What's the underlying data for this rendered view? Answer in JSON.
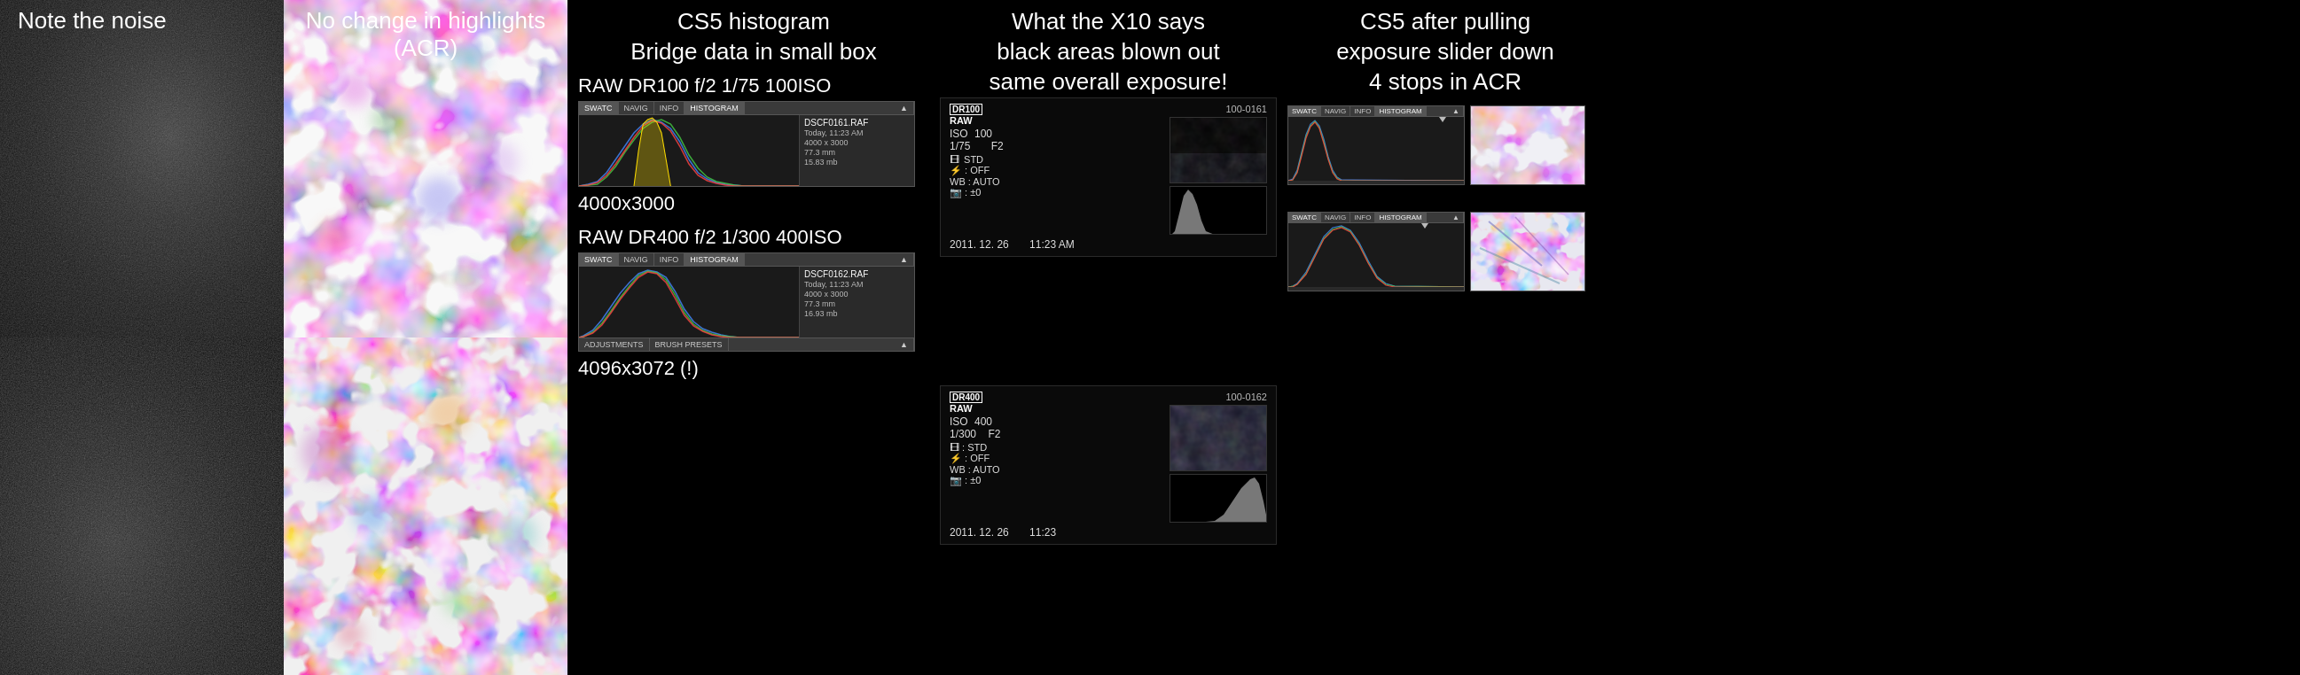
{
  "col1": {
    "label": "Note the noise"
  },
  "col2": {
    "label": "No change in highlights (ACR)"
  },
  "col3": {
    "label_line1": "CS5 histogram",
    "label_line2": "Bridge data in small box",
    "top_raw_label": "RAW DR100 f/2 1/75 100ISO",
    "top_size": "4000x3000",
    "top_filename": "DSCF0161.RAF",
    "top_file_info1": "Today, 11:23 AM",
    "top_file_info2": "4000 x 3000",
    "top_file_info3": "77.3 mm",
    "top_file_info4": "15.83 mb",
    "bottom_raw_label": "RAW DR400 f/2 1/300 400ISO",
    "bottom_size": "4096x3072 (!)",
    "bottom_filename": "DSCF0162.RAF",
    "bottom_file_info1": "Today, 11:23 AM",
    "bottom_file_info2": "4000 x 3000",
    "bottom_file_info3": "77.3 mm",
    "bottom_file_info4": "16.93 mb",
    "tab1": "SWATC",
    "tab2": "NAVIG",
    "tab3": "INFO",
    "tab4": "HISTOGRAM",
    "tab_adjustments": "ADJUSTMENTS",
    "tab_brushpresets": "BRUSH PRESETS"
  },
  "col4": {
    "label_line1": "What the X10 says",
    "label_line2": "black areas blown out",
    "label_line3": "same overall exposure!",
    "top_filename": "100-0161",
    "top_dr": "DR100",
    "top_raw": "RAW",
    "top_iso_label": "ISO",
    "top_iso_val": "100",
    "top_ss": "1/75",
    "top_aperture": "F2",
    "top_std": "STD",
    "top_flash": "OFF",
    "top_wb": "AUTO",
    "top_ev": "±0",
    "top_date": "2011. 12. 26",
    "top_time": "11:23 AM",
    "bottom_filename": "100-0162",
    "bottom_dr": "DR400",
    "bottom_raw": "RAW",
    "bottom_iso_label": "ISO",
    "bottom_iso_val": "400",
    "bottom_ss": "1/300",
    "bottom_aperture": "F2",
    "bottom_std": "STD",
    "bottom_flash": "OFF",
    "bottom_wb": "AUTO",
    "bottom_ev": "±0",
    "bottom_date": "2011. 12. 26",
    "bottom_time": "11:23"
  },
  "col5": {
    "label_line1": "CS5 after pulling",
    "label_line2": "exposure slider down",
    "label_line3": "4 stops in ACR",
    "tab1": "SWATC",
    "tab2": "NAVIG",
    "tab3": "INFO",
    "tab4": "HISTOGRAM"
  }
}
